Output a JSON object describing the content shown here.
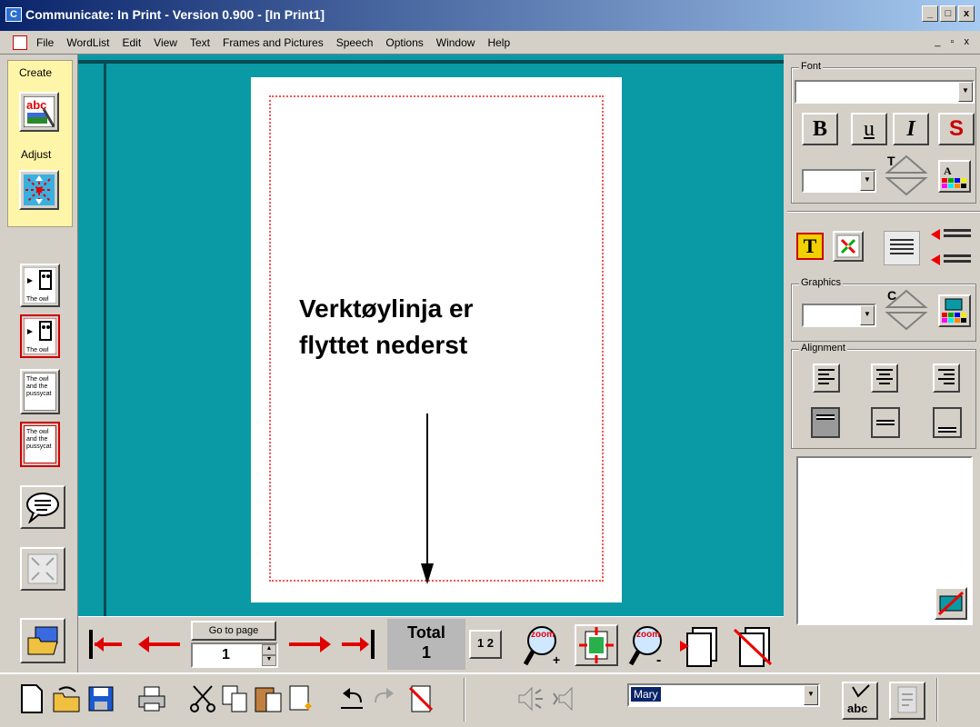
{
  "window": {
    "title": "Communicate: In Print - Version 0.900 - [In Print1]",
    "minimize": "_",
    "maximize": "□",
    "close": "x"
  },
  "menu": [
    "File",
    "WordList",
    "Edit",
    "View",
    "Text",
    "Frames and Pictures",
    "Speech",
    "Options",
    "Window",
    "Help"
  ],
  "left_panel": {
    "create_label": "Create",
    "adjust_label": "Adjust",
    "symbol_buttons": [
      {
        "caption": "The owl"
      },
      {
        "caption": "The owl"
      },
      {
        "caption": "The owl and the pussycat"
      },
      {
        "caption": "The owl and the pussycat"
      }
    ]
  },
  "document": {
    "text_line1": "Verktøylinja er",
    "text_line2": "flyttet nederst"
  },
  "right_panel": {
    "font_group": "Font",
    "font_value": "",
    "bold_label": "B",
    "underline_label": "u",
    "italic_label": "I",
    "strike_label": "S",
    "size_value": "",
    "graphics_group": "Graphics",
    "graphics_value": "",
    "alignment_group": "Alignment",
    "t_label": "T",
    "c_label": "C"
  },
  "navigation": {
    "goto_label": "Go to page",
    "page_value": "1",
    "total_label": "Total",
    "total_value": "1",
    "pages_label": "1 2"
  },
  "toolbar": {
    "voice_value": "Mary",
    "spell_label": "abc"
  },
  "colors": {
    "canvas": "#0a9aa6",
    "create_panel": "#fff5a8",
    "nav_arrow": "#e00000",
    "margin_dots": "#ff5050"
  }
}
